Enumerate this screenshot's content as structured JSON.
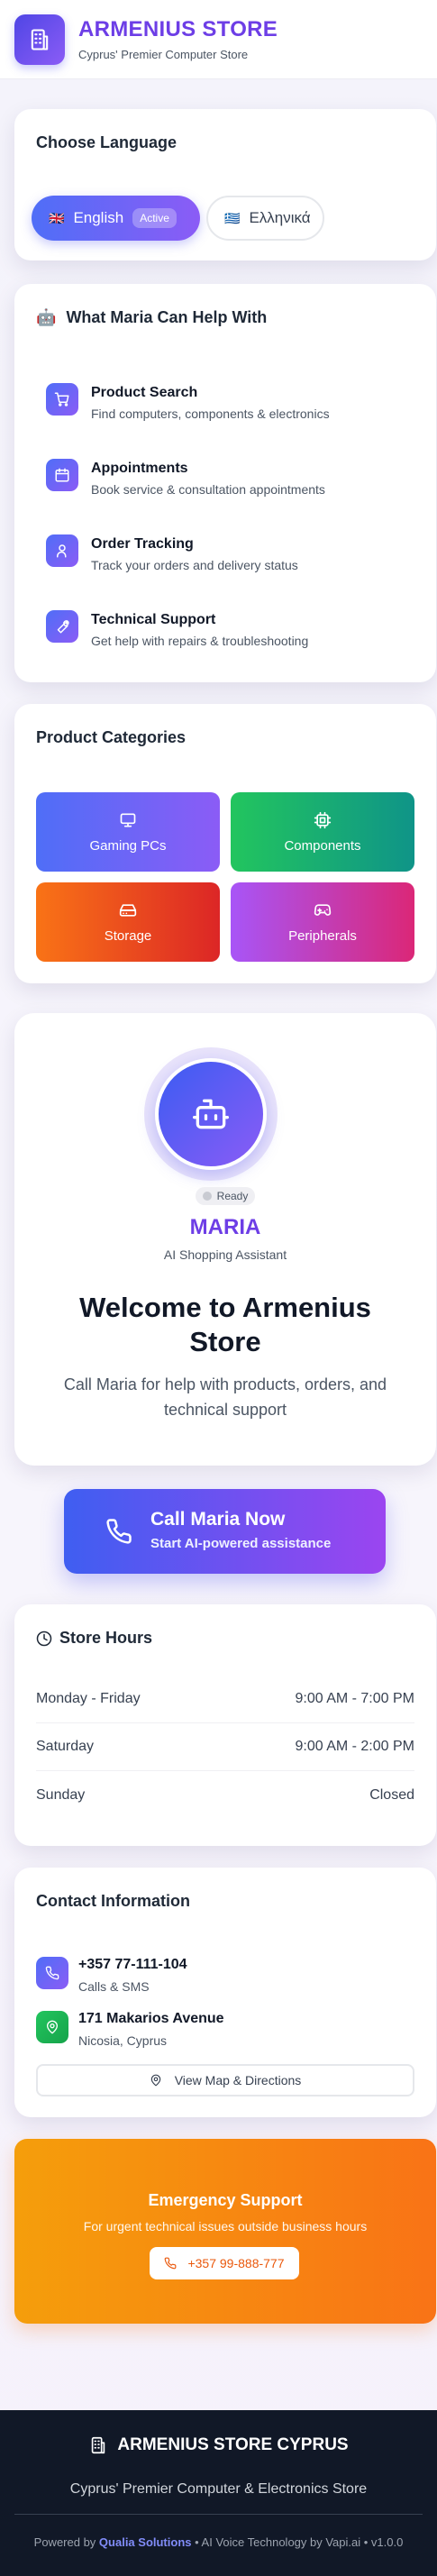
{
  "header": {
    "title": "ARMENIUS STORE",
    "subtitle": "Cyprus' Premier Computer Store",
    "logo_icon": "building-icon"
  },
  "language": {
    "title": "Choose Language",
    "options": [
      {
        "flag": "🇬🇧",
        "label": "English",
        "badge": "Active"
      },
      {
        "flag": "🇬🇷",
        "label": "Ελληνικά"
      }
    ]
  },
  "help": {
    "title_icon": "🤖",
    "title": "What Maria Can Help With",
    "items": [
      {
        "title": "Product Search",
        "desc": "Find computers, components & electronics",
        "icon": "cart-icon"
      },
      {
        "title": "Appointments",
        "desc": "Book service & consultation appointments",
        "icon": "calendar-icon"
      },
      {
        "title": "Order Tracking",
        "desc": "Track your orders and delivery status",
        "icon": "user-icon"
      },
      {
        "title": "Technical Support",
        "desc": "Get help with repairs & troubleshooting",
        "icon": "wrench-icon"
      }
    ]
  },
  "categories": {
    "title": "Product Categories",
    "items": [
      {
        "label": "Gaming PCs",
        "icon": "monitor-icon",
        "from": "#4f6ef7",
        "to": "#8b5cf6"
      },
      {
        "label": "Components",
        "icon": "cpu-icon",
        "from": "#22c55e",
        "to": "#0f9488"
      },
      {
        "label": "Storage",
        "icon": "hard-drive-icon",
        "from": "#f97316",
        "to": "#dc2626"
      },
      {
        "label": "Peripherals",
        "icon": "gamepad-icon",
        "from": "#a855f7",
        "to": "#db2777"
      }
    ]
  },
  "maria": {
    "status": "Ready",
    "name": "MARIA",
    "role": "AI Shopping Assistant",
    "welcome": "Welcome to Armenius Store",
    "description": "Call Maria for help with products, orders, and technical support"
  },
  "call": {
    "label": "Call Maria Now",
    "sublabel": "Start AI-powered assistance"
  },
  "hours": {
    "title": "Store Hours",
    "rows": [
      {
        "day": "Monday - Friday",
        "time": "9:00 AM - 7:00 PM"
      },
      {
        "day": "Saturday",
        "time": "9:00 AM - 2:00 PM"
      },
      {
        "day": "Sunday",
        "time": "Closed"
      }
    ]
  },
  "contact": {
    "title": "Contact Information",
    "phone": "+357 77-111-104",
    "phone_sub": "Calls & SMS",
    "address": "171 Makarios Avenue",
    "address_sub": "Nicosia, Cyprus",
    "map_button": "View Map & Directions"
  },
  "emergency": {
    "title": "Emergency Support",
    "desc": "For urgent technical issues outside business hours",
    "phone": "+357 99-888-777"
  },
  "footer": {
    "title": "ARMENIUS STORE CYPRUS",
    "subtitle": "Cyprus' Premier Computer & Electronics Store",
    "powered_prefix": "Powered by ",
    "powered_brand": "Qualia Solutions",
    "powered_suffix": " • AI Voice Technology by Vapi.ai • v1.0.0"
  },
  "colors": {
    "accent": "#6d3ee6",
    "primary_blue": "#4f6ef7",
    "emergency": "#f97316",
    "footer_bg": "#111827"
  }
}
